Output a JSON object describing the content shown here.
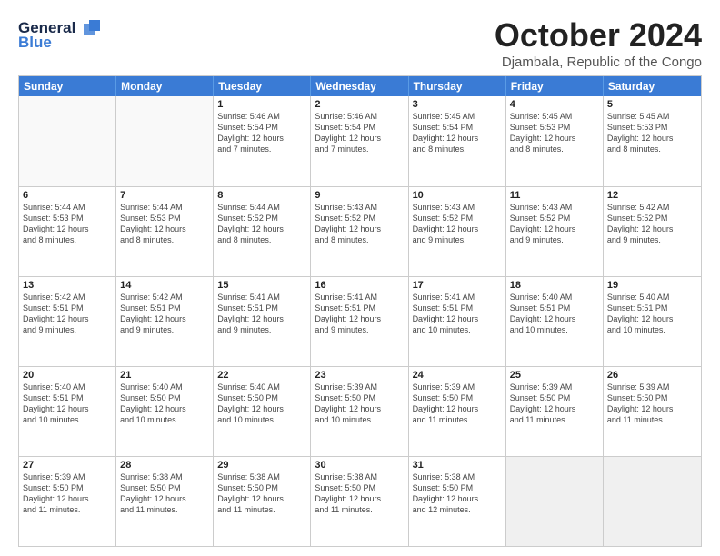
{
  "logo": {
    "line1": "General",
    "line2": "Blue"
  },
  "title": "October 2024",
  "subtitle": "Djambala, Republic of the Congo",
  "days_of_week": [
    "Sunday",
    "Monday",
    "Tuesday",
    "Wednesday",
    "Thursday",
    "Friday",
    "Saturday"
  ],
  "weeks": [
    [
      {
        "day": "",
        "info": "",
        "empty": true
      },
      {
        "day": "",
        "info": "",
        "empty": true
      },
      {
        "day": "1",
        "info": "Sunrise: 5:46 AM\nSunset: 5:54 PM\nDaylight: 12 hours\nand 7 minutes."
      },
      {
        "day": "2",
        "info": "Sunrise: 5:46 AM\nSunset: 5:54 PM\nDaylight: 12 hours\nand 7 minutes."
      },
      {
        "day": "3",
        "info": "Sunrise: 5:45 AM\nSunset: 5:54 PM\nDaylight: 12 hours\nand 8 minutes."
      },
      {
        "day": "4",
        "info": "Sunrise: 5:45 AM\nSunset: 5:53 PM\nDaylight: 12 hours\nand 8 minutes."
      },
      {
        "day": "5",
        "info": "Sunrise: 5:45 AM\nSunset: 5:53 PM\nDaylight: 12 hours\nand 8 minutes."
      }
    ],
    [
      {
        "day": "6",
        "info": "Sunrise: 5:44 AM\nSunset: 5:53 PM\nDaylight: 12 hours\nand 8 minutes."
      },
      {
        "day": "7",
        "info": "Sunrise: 5:44 AM\nSunset: 5:53 PM\nDaylight: 12 hours\nand 8 minutes."
      },
      {
        "day": "8",
        "info": "Sunrise: 5:44 AM\nSunset: 5:52 PM\nDaylight: 12 hours\nand 8 minutes."
      },
      {
        "day": "9",
        "info": "Sunrise: 5:43 AM\nSunset: 5:52 PM\nDaylight: 12 hours\nand 8 minutes."
      },
      {
        "day": "10",
        "info": "Sunrise: 5:43 AM\nSunset: 5:52 PM\nDaylight: 12 hours\nand 9 minutes."
      },
      {
        "day": "11",
        "info": "Sunrise: 5:43 AM\nSunset: 5:52 PM\nDaylight: 12 hours\nand 9 minutes."
      },
      {
        "day": "12",
        "info": "Sunrise: 5:42 AM\nSunset: 5:52 PM\nDaylight: 12 hours\nand 9 minutes."
      }
    ],
    [
      {
        "day": "13",
        "info": "Sunrise: 5:42 AM\nSunset: 5:51 PM\nDaylight: 12 hours\nand 9 minutes."
      },
      {
        "day": "14",
        "info": "Sunrise: 5:42 AM\nSunset: 5:51 PM\nDaylight: 12 hours\nand 9 minutes."
      },
      {
        "day": "15",
        "info": "Sunrise: 5:41 AM\nSunset: 5:51 PM\nDaylight: 12 hours\nand 9 minutes."
      },
      {
        "day": "16",
        "info": "Sunrise: 5:41 AM\nSunset: 5:51 PM\nDaylight: 12 hours\nand 9 minutes."
      },
      {
        "day": "17",
        "info": "Sunrise: 5:41 AM\nSunset: 5:51 PM\nDaylight: 12 hours\nand 10 minutes."
      },
      {
        "day": "18",
        "info": "Sunrise: 5:40 AM\nSunset: 5:51 PM\nDaylight: 12 hours\nand 10 minutes."
      },
      {
        "day": "19",
        "info": "Sunrise: 5:40 AM\nSunset: 5:51 PM\nDaylight: 12 hours\nand 10 minutes."
      }
    ],
    [
      {
        "day": "20",
        "info": "Sunrise: 5:40 AM\nSunset: 5:51 PM\nDaylight: 12 hours\nand 10 minutes."
      },
      {
        "day": "21",
        "info": "Sunrise: 5:40 AM\nSunset: 5:50 PM\nDaylight: 12 hours\nand 10 minutes."
      },
      {
        "day": "22",
        "info": "Sunrise: 5:40 AM\nSunset: 5:50 PM\nDaylight: 12 hours\nand 10 minutes."
      },
      {
        "day": "23",
        "info": "Sunrise: 5:39 AM\nSunset: 5:50 PM\nDaylight: 12 hours\nand 10 minutes."
      },
      {
        "day": "24",
        "info": "Sunrise: 5:39 AM\nSunset: 5:50 PM\nDaylight: 12 hours\nand 11 minutes."
      },
      {
        "day": "25",
        "info": "Sunrise: 5:39 AM\nSunset: 5:50 PM\nDaylight: 12 hours\nand 11 minutes."
      },
      {
        "day": "26",
        "info": "Sunrise: 5:39 AM\nSunset: 5:50 PM\nDaylight: 12 hours\nand 11 minutes."
      }
    ],
    [
      {
        "day": "27",
        "info": "Sunrise: 5:39 AM\nSunset: 5:50 PM\nDaylight: 12 hours\nand 11 minutes."
      },
      {
        "day": "28",
        "info": "Sunrise: 5:38 AM\nSunset: 5:50 PM\nDaylight: 12 hours\nand 11 minutes."
      },
      {
        "day": "29",
        "info": "Sunrise: 5:38 AM\nSunset: 5:50 PM\nDaylight: 12 hours\nand 11 minutes."
      },
      {
        "day": "30",
        "info": "Sunrise: 5:38 AM\nSunset: 5:50 PM\nDaylight: 12 hours\nand 11 minutes."
      },
      {
        "day": "31",
        "info": "Sunrise: 5:38 AM\nSunset: 5:50 PM\nDaylight: 12 hours\nand 12 minutes."
      },
      {
        "day": "",
        "info": "",
        "empty": true,
        "shaded": true
      },
      {
        "day": "",
        "info": "",
        "empty": true,
        "shaded": true
      }
    ]
  ]
}
